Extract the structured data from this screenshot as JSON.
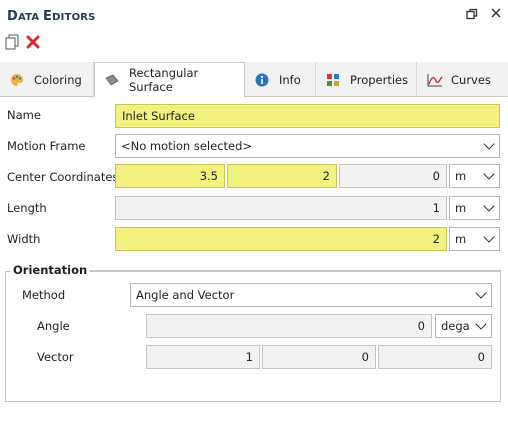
{
  "window": {
    "title_first": "D",
    "title_rest": "ATA ",
    "title_second_first": "E",
    "title_second_rest": "DITORS"
  },
  "tabs": [
    {
      "label": "Coloring",
      "icon": "palette-icon"
    },
    {
      "label": "Rectangular Surface",
      "icon": "surface-icon"
    },
    {
      "label": "Info",
      "icon": "info-icon"
    },
    {
      "label": "Properties",
      "icon": "properties-icon"
    },
    {
      "label": "Curves",
      "icon": "curves-icon"
    }
  ],
  "form": {
    "name_label": "Name",
    "name_value": "Inlet Surface",
    "motion_label": "Motion Frame",
    "motion_value": "<No motion selected>",
    "center_label": "Center Coordinates",
    "center_x": "3.5",
    "center_y": "2",
    "center_z": "0",
    "center_unit": "m",
    "length_label": "Length",
    "length_value": "1",
    "length_unit": "m",
    "width_label": "Width",
    "width_value": "2",
    "width_unit": "m"
  },
  "orientation": {
    "title": "Orientation",
    "method_label": "Method",
    "method_value": "Angle and Vector",
    "angle_label": "Angle",
    "angle_value": "0",
    "angle_unit": "dega",
    "vector_label": "Vector",
    "vector_x": "1",
    "vector_y": "0",
    "vector_z": "0"
  },
  "colors": {
    "required_field": "#f4f27f",
    "title_text": "#243a55",
    "delete_red": "#d62a2a"
  }
}
